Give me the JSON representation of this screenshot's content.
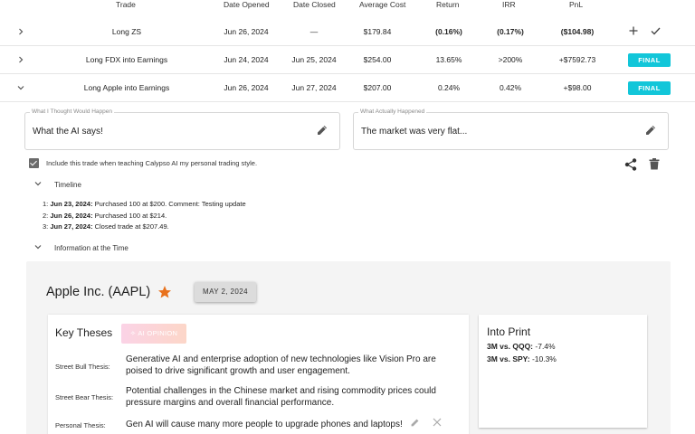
{
  "table": {
    "headers": [
      "Trade",
      "Date Opened",
      "Date Closed",
      "Average Cost",
      "Return",
      "IRR",
      "PnL"
    ],
    "rows": [
      {
        "trade": "Long ZS",
        "opened": "Jun 26, 2024",
        "closed": "—",
        "avg_cost": "$179.84",
        "return": "(0.16%)",
        "irr": "(0.17%)",
        "pnl": "($104.98)",
        "status": ""
      },
      {
        "trade": "Long FDX into Earnings",
        "opened": "Jun 24, 2024",
        "closed": "Jun 25, 2024",
        "avg_cost": "$254.00",
        "return": "13.65%",
        "irr": ">200%",
        "pnl": "+$7592.73",
        "status": "FINAL"
      },
      {
        "trade": "Long Apple into Earnings",
        "opened": "Jun 26, 2024",
        "closed": "Jun 27, 2024",
        "avg_cost": "$207.00",
        "return": "0.24%",
        "irr": "0.42%",
        "pnl": "+$98.00",
        "status": "FINAL"
      }
    ]
  },
  "row_actions": {
    "add_icon": "plus-icon",
    "confirm_icon": "check-icon"
  },
  "expanded": {
    "thought_label": "What I Thought Would Happen",
    "thought_value": "What the AI says!",
    "actual_label": "What Actually Happened",
    "actual_value": "The market was very flat...",
    "include_label": "Include this trade when teaching Calypso AI my personal trading style.",
    "include_checked": true,
    "timeline_label": "Timeline",
    "timeline": [
      {
        "num": "1:",
        "date": "Jun 23, 2024:",
        "text": "Purchased 100 at $200. Comment: Testing update"
      },
      {
        "num": "2:",
        "date": "Jun 26, 2024:",
        "text": "Purchased 100 at $214."
      },
      {
        "num": "3:",
        "date": "Jun 27, 2024:",
        "text": "Closed trade at $207.49."
      }
    ],
    "info_label": "Information at the Time"
  },
  "info": {
    "company": "Apple Inc. (AAPL)",
    "date_chip": "MAY 2, 2024",
    "key_theses_title": "Key Theses",
    "ai_opinion_label": "AI OPINION",
    "theses": [
      {
        "label": "Street Bull Thesis:",
        "text": "Generative AI and enterprise adoption of new technologies like Vision Pro are poised to drive significant growth and user engagement."
      },
      {
        "label": "Street Bear Thesis:",
        "text": "Potential challenges in the Chinese market and rising commodity prices could pressure margins and overall financial performance."
      },
      {
        "label": "Personal Thesis:",
        "text": "Gen AI will cause many more people to upgrade phones and laptops!"
      }
    ],
    "into_print_title": "Into Print",
    "into_print": [
      {
        "label": "3M vs. QQQ:",
        "value": "-7.4%"
      },
      {
        "label": "3M vs. SPY:",
        "value": "-10.3%"
      }
    ]
  },
  "colors": {
    "accent_final": "#12c6d9",
    "negative": "#d32f2f",
    "positive": "#2e9e3e",
    "star": "#e8711c"
  }
}
